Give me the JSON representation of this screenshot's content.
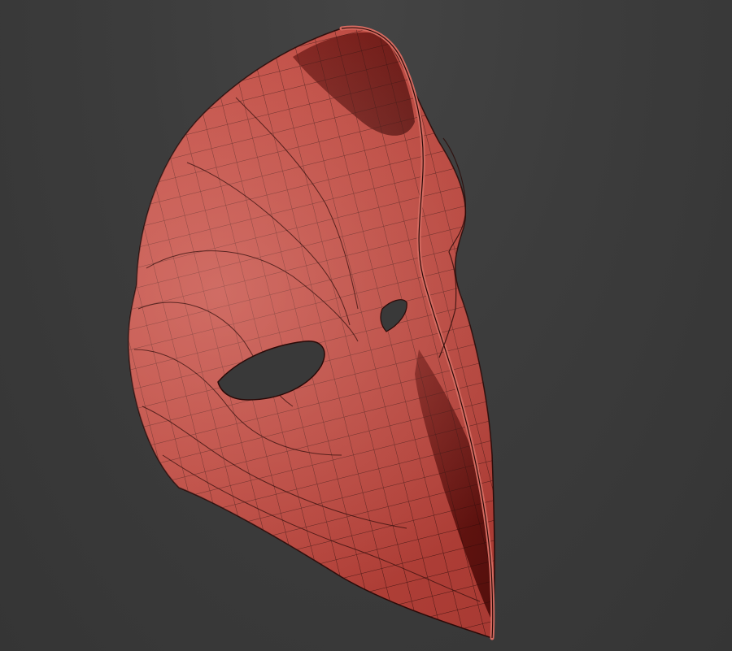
{
  "viewport": {
    "background": "#3b3b3b",
    "object": "mask-mesh-icon",
    "render_mode": "shaded-wireframe",
    "mesh_color": "#c0483e",
    "edge_color": "#2a0a08"
  }
}
